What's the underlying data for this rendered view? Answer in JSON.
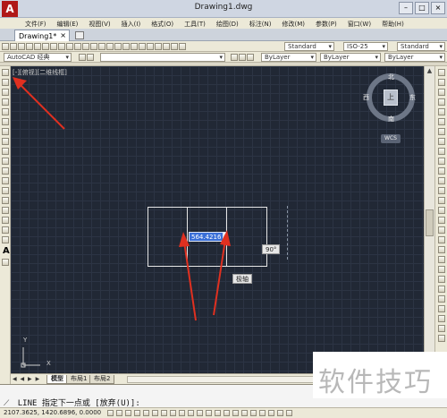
{
  "window": {
    "title": "Drawing1.dwg",
    "app_logo": "A"
  },
  "menu": [
    "文件(F)",
    "编辑(E)",
    "视图(V)",
    "插入(I)",
    "格式(O)",
    "工具(T)",
    "绘图(D)",
    "标注(N)",
    "修改(M)",
    "参数(P)",
    "窗口(W)",
    "帮助(H)"
  ],
  "doc_tab": {
    "label": "Drawing1*",
    "close": "×"
  },
  "toolbar": {
    "text_style": "Standard",
    "dim_style": "ISO-25",
    "table_style": "Standard",
    "workspace": "AutoCAD 经典",
    "layer_color": "ByLayer",
    "linetype": "ByLayer",
    "lineweight": "ByLayer"
  },
  "viewport_label": "[-][俯视][二维线框]",
  "viewcube": {
    "face": "上",
    "north": "北",
    "south": "南",
    "east": "东",
    "west": "西",
    "wcs": "WCS"
  },
  "drawing": {
    "dynamic_input_value": "564.4216",
    "angle_tooltip": "90°",
    "ortho_tooltip": "极轴",
    "ucs_x": "X",
    "ucs_y": "Y"
  },
  "layout_tabs": {
    "nav": "◀ ◀ ▶ ▶",
    "tabs": [
      "模型",
      "布局1",
      "布局2"
    ]
  },
  "command": {
    "history": "",
    "icon": "⟋",
    "prompt": "LINE 指定下一点或 [放弃(U)]:"
  },
  "status": {
    "coords": "2107.3625, 1420.6896, 0.0000"
  },
  "watermark": "软件技巧",
  "colors": {
    "canvas": "#212835",
    "arrow": "#e03020",
    "selection": "#3a6fd8"
  }
}
